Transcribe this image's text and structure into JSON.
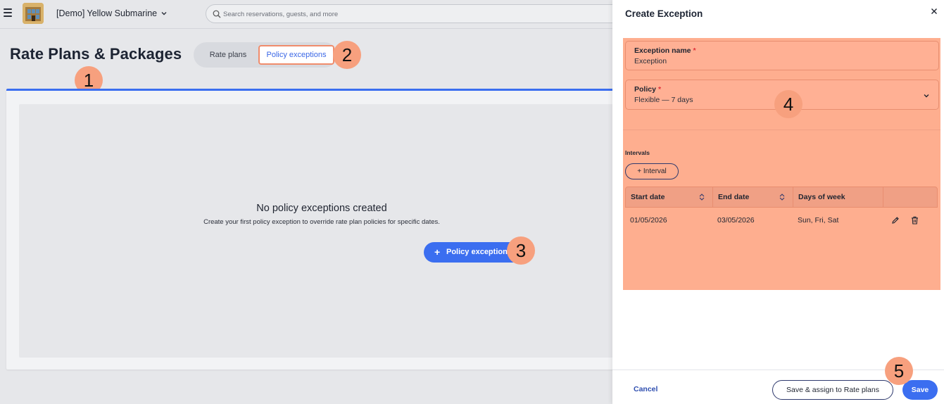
{
  "header": {
    "hotel_name": "[Demo] Yellow Submarine",
    "search_placeholder": "Search reservations, guests, and more"
  },
  "page": {
    "title": "Rate Plans & Packages",
    "tabs": [
      {
        "label": "Rate plans",
        "active": false
      },
      {
        "label": "Policy exceptions",
        "active": true
      }
    ]
  },
  "empty_state": {
    "title": "No policy exceptions created",
    "description": "Create your first policy exception to override rate plan policies for specific dates.",
    "button_label": "Policy exception",
    "button_icon": "plus-icon"
  },
  "drawer": {
    "title": "Create Exception",
    "exception_name": {
      "label": "Exception name",
      "required_mark": "*",
      "value": "Exception"
    },
    "policy": {
      "label": "Policy",
      "required_mark": "*",
      "value": "Flexible — 7 days"
    },
    "intervals": {
      "label": "Intervals",
      "add_button": "+ Interval",
      "columns": [
        "Start date",
        "End date",
        "Days of week"
      ],
      "rows": [
        {
          "start": "01/05/2026",
          "end": "03/05/2026",
          "days": "Sun, Fri, Sat"
        }
      ]
    },
    "footer": {
      "cancel": "Cancel",
      "save_assign": "Save & assign to Rate plans",
      "save": "Save"
    }
  },
  "annotations": [
    "1",
    "2",
    "3",
    "4",
    "5"
  ],
  "colors": {
    "accent": "#3b6ef0",
    "highlight": "#feae8f",
    "badge": "#f7a07e",
    "required": "#e0323a"
  }
}
